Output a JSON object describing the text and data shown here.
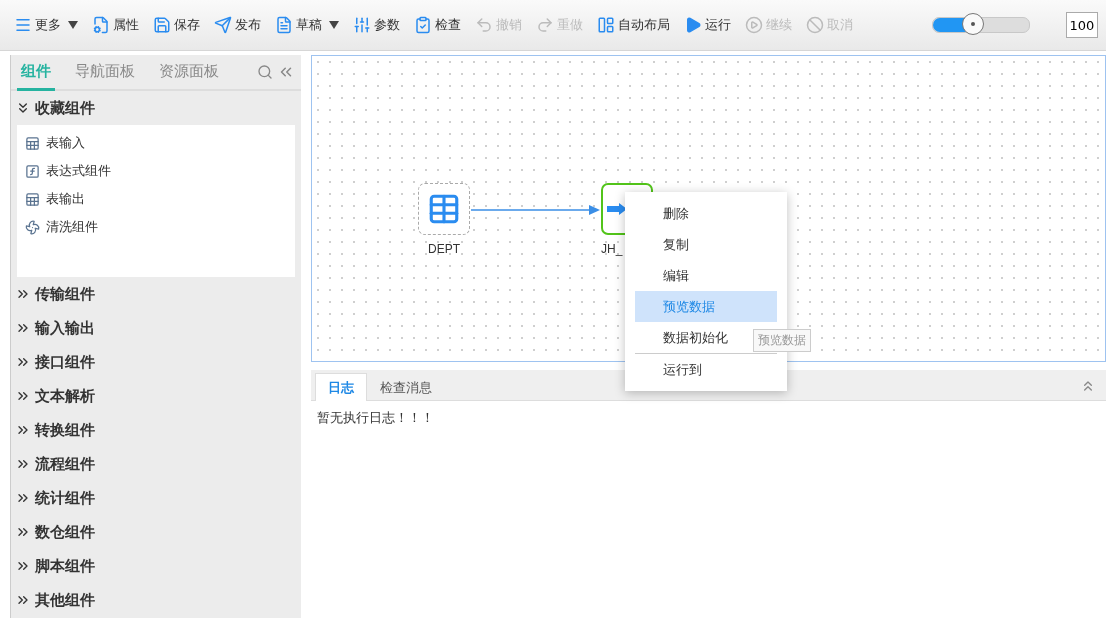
{
  "toolbar": {
    "items": [
      {
        "kind": "menu",
        "label": "更多",
        "dropdown": true,
        "disabled": false
      },
      {
        "kind": "properties",
        "label": "属性",
        "dropdown": false,
        "disabled": false
      },
      {
        "kind": "save",
        "label": "保存",
        "dropdown": false,
        "disabled": false
      },
      {
        "kind": "publish",
        "label": "发布",
        "dropdown": false,
        "disabled": false
      },
      {
        "kind": "draft",
        "label": "草稿",
        "dropdown": true,
        "disabled": false
      },
      {
        "kind": "params",
        "label": "参数",
        "dropdown": false,
        "disabled": false
      },
      {
        "kind": "check",
        "label": "检查",
        "dropdown": false,
        "disabled": false
      },
      {
        "kind": "undo",
        "label": "撤销",
        "dropdown": false,
        "disabled": true
      },
      {
        "kind": "redo",
        "label": "重做",
        "dropdown": false,
        "disabled": true
      },
      {
        "kind": "layout",
        "label": "自动布局",
        "dropdown": false,
        "disabled": false
      },
      {
        "kind": "run",
        "label": "运行",
        "dropdown": false,
        "disabled": false
      },
      {
        "kind": "resume",
        "label": "继续",
        "dropdown": false,
        "disabled": true
      },
      {
        "kind": "cancel",
        "label": "取消",
        "dropdown": false,
        "disabled": true
      }
    ],
    "zoom_slider": {
      "level": 0.42
    },
    "zoom_value": "100"
  },
  "sidebar": {
    "tabs": [
      {
        "label": "组件",
        "selected": true
      },
      {
        "label": "导航面板",
        "selected": false
      },
      {
        "label": "资源面板",
        "selected": false
      }
    ],
    "sections": [
      {
        "title": "收藏组件",
        "expanded": true,
        "items": [
          {
            "kind": "table-input",
            "label": "表输入"
          },
          {
            "kind": "expression",
            "label": "表达式组件"
          },
          {
            "kind": "table-output",
            "label": "表输出"
          },
          {
            "kind": "cleanse",
            "label": "清洗组件"
          }
        ]
      },
      {
        "title": "传输组件",
        "expanded": false
      },
      {
        "title": "输入输出",
        "expanded": false
      },
      {
        "title": "接口组件",
        "expanded": false
      },
      {
        "title": "文本解析",
        "expanded": false
      },
      {
        "title": "转换组件",
        "expanded": false
      },
      {
        "title": "流程组件",
        "expanded": false
      },
      {
        "title": "统计组件",
        "expanded": false
      },
      {
        "title": "数仓组件",
        "expanded": false
      },
      {
        "title": "脚本组件",
        "expanded": false
      },
      {
        "title": "其他组件",
        "expanded": false
      }
    ]
  },
  "canvas": {
    "nodes": [
      {
        "kind": "table-input",
        "label": "DEPT",
        "selected": false
      },
      {
        "kind": "transform",
        "label": "JH_",
        "selected": true
      }
    ]
  },
  "context_menu": {
    "items": [
      {
        "label": "删除",
        "selected": false,
        "separator_before": false
      },
      {
        "label": "复制",
        "selected": false,
        "separator_before": false
      },
      {
        "label": "编辑",
        "selected": false,
        "separator_before": false
      },
      {
        "label": "预览数据",
        "selected": true,
        "separator_before": false
      },
      {
        "label": "数据初始化",
        "selected": false,
        "separator_before": false
      },
      {
        "label": "运行到",
        "selected": false,
        "separator_before": true
      }
    ]
  },
  "tooltip": "预览数据",
  "bottom_panel": {
    "tabs": [
      {
        "label": "日志",
        "selected": true
      },
      {
        "label": "检查消息",
        "selected": false
      }
    ],
    "log_text": "暂无执行日志！！！"
  }
}
